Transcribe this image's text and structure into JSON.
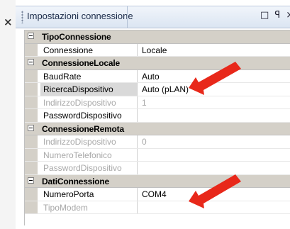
{
  "window": {
    "close_glyph": "×"
  },
  "panel": {
    "title": "Impostazioni connessione",
    "pin_glyph": "□ ꟼ ×"
  },
  "accent_arrow_color": "#e8281a",
  "categories": [
    {
      "name": "TipoConnessione",
      "properties": [
        {
          "name": "Connessione",
          "value": "Locale",
          "enabled": true
        }
      ]
    },
    {
      "name": "ConnessioneLocale",
      "properties": [
        {
          "name": "BaudRate",
          "value": "Auto",
          "enabled": true
        },
        {
          "name": "RicercaDispositivo",
          "value": "Auto (pLAN)",
          "enabled": true,
          "selected": true
        },
        {
          "name": "IndirizzoDispositivo",
          "value": "1",
          "enabled": false
        },
        {
          "name": "PasswordDispositivo",
          "value": "",
          "enabled": true
        }
      ]
    },
    {
      "name": "ConnessioneRemota",
      "properties": [
        {
          "name": "IndirizzoDispositivo",
          "value": "0",
          "enabled": false
        },
        {
          "name": "NumeroTelefonico",
          "value": "",
          "enabled": false
        },
        {
          "name": "PasswordDispositivo",
          "value": "",
          "enabled": false
        }
      ]
    },
    {
      "name": "DatiConnessione",
      "properties": [
        {
          "name": "NumeroPorta",
          "value": "COM4",
          "enabled": true
        },
        {
          "name": "TipoModem",
          "value": "",
          "enabled": false
        }
      ]
    }
  ]
}
